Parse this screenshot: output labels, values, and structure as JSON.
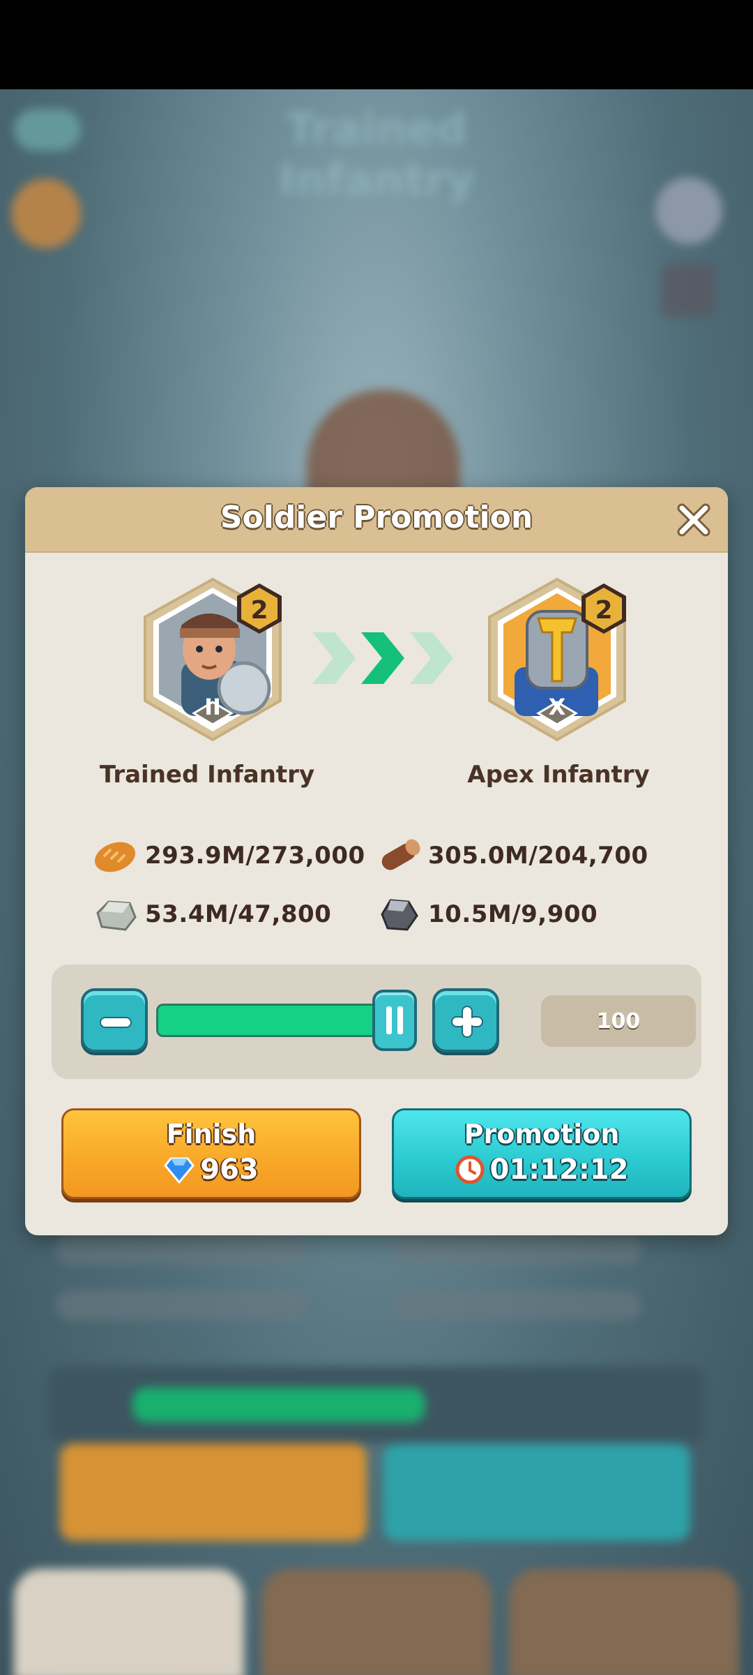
{
  "background": {
    "title": "Trained Infantry"
  },
  "modal": {
    "title": "Soldier Promotion",
    "from_soldier": {
      "name": "Trained Infantry",
      "level": "2",
      "tier": "II"
    },
    "to_soldier": {
      "name": "Apex Infantry",
      "level": "2",
      "tier": "X"
    },
    "resources": [
      {
        "icon": "bread-icon",
        "value": "293.9M/273,000"
      },
      {
        "icon": "wood-log-icon",
        "value": "305.0M/204,700"
      },
      {
        "icon": "stone-icon",
        "value": "53.4M/47,800"
      },
      {
        "icon": "iron-ore-icon",
        "value": "10.5M/9,900"
      }
    ],
    "quantity": {
      "value": "100",
      "slider_fraction": 1.0
    },
    "finish_button": {
      "label": "Finish",
      "cost": "963"
    },
    "promotion_button": {
      "label": "Promotion",
      "time": "01:12:12"
    },
    "colors": {
      "header": "#d9bf92",
      "panel": "#ebe7de",
      "finish": "#f9a929",
      "promotion": "#2dcbd2",
      "slider_fill": "#14d185"
    }
  }
}
